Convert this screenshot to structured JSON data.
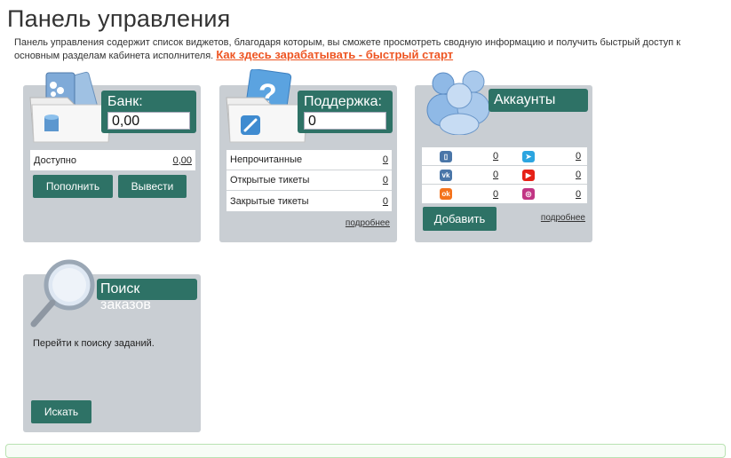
{
  "page": {
    "title": "Панель управления",
    "intro": "Панель управления содержит список виджетов, благодаря которым, вы сможете просмотреть сводную информацию и получить быстрый доступ к основным разделам кабинета исполнителя.",
    "quick_start_link": "Как здесь зарабатывать - быстрый старт"
  },
  "bank": {
    "title": "Банк:",
    "balance": "0,00",
    "available_label": "Доступно",
    "available_value": "0,00",
    "deposit_button": "Пополнить",
    "withdraw_button": "Вывести"
  },
  "support": {
    "title": "Поддержка:",
    "count": "0",
    "rows": [
      {
        "label": "Непрочитанные",
        "value": "0"
      },
      {
        "label": "Открытые тикеты",
        "value": "0"
      },
      {
        "label": "Закрытые тикеты",
        "value": "0"
      }
    ],
    "more_link": "подробнее"
  },
  "accounts": {
    "title": "Аккаунты",
    "rows": [
      [
        {
          "icon": "vk-book-icon",
          "count": "0",
          "color": "#4a76a8"
        },
        {
          "icon": "telegram-icon",
          "count": "0",
          "color": "#2ca5e0"
        }
      ],
      [
        {
          "icon": "vk-icon",
          "count": "0",
          "color": "#4a76a8"
        },
        {
          "icon": "youtube-icon",
          "count": "0",
          "color": "#e62117"
        }
      ],
      [
        {
          "icon": "odnoklassniki-icon",
          "count": "0",
          "color": "#f4731c"
        },
        {
          "icon": "instagram-icon",
          "count": "0",
          "color": "#c13584"
        }
      ]
    ],
    "add_button": "Добавить",
    "more_link": "подробнее"
  },
  "search": {
    "title": "Поиск заказов",
    "text": "Перейти к поиску заданий.",
    "search_button": "Искать"
  },
  "colors": {
    "accent": "#2e7266",
    "widget_bg": "#c9ced3",
    "link_orange": "#ee5522"
  }
}
